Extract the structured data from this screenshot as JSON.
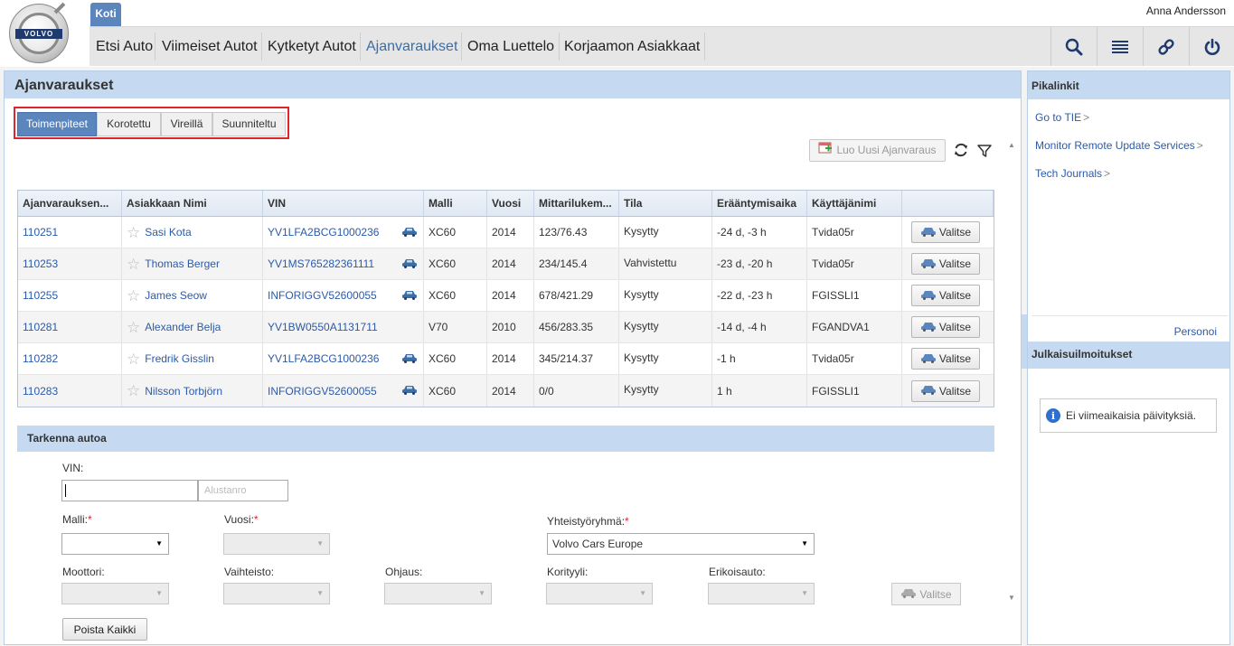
{
  "header": {
    "logo_text": "VOLVO",
    "home_tab": "Koti",
    "user": "Anna Andersson",
    "nav": [
      {
        "label": "Etsi Auto"
      },
      {
        "label": "Viimeiset Autot"
      },
      {
        "label": "Kytketyt Autot"
      },
      {
        "label": "Ajanvaraukset"
      },
      {
        "label": "Oma Luettelo"
      },
      {
        "label": "Korjaamon Asiakkaat"
      }
    ],
    "icons": [
      "search-icon",
      "list-icon",
      "link-icon",
      "power-icon"
    ]
  },
  "main": {
    "title": "Ajanvaraukset",
    "tabs": [
      {
        "label": "Toimenpiteet",
        "active": true
      },
      {
        "label": "Korotettu"
      },
      {
        "label": "Vireillä"
      },
      {
        "label": "Suunniteltu"
      }
    ],
    "new_button": "Luo Uusi Ajanvaraus",
    "columns": [
      "Ajanvarauksen...",
      "Asiakkaan Nimi",
      "VIN",
      "Malli",
      "Vuosi",
      "Mittarilukem...",
      "Tila",
      "Erääntymisaika",
      "Käyttäjänimi",
      ""
    ],
    "rows": [
      {
        "id": "110251",
        "name": "Sasi Kota",
        "vin": "YV1LFA2BCG1000236",
        "connected": true,
        "model": "XC60",
        "year": "2014",
        "mileage": "123/76.43",
        "status": "Kysytty",
        "due": "-24 d, -3 h",
        "user": "Tvida05r",
        "action": "Valitse"
      },
      {
        "id": "110253",
        "name": "Thomas Berger",
        "vin": "YV1MS765282361111",
        "connected": true,
        "model": "XC60",
        "year": "2014",
        "mileage": "234/145.4",
        "status": "Vahvistettu",
        "due": "-23 d, -20 h",
        "user": "Tvida05r",
        "action": "Valitse"
      },
      {
        "id": "110255",
        "name": "James Seow",
        "vin": "INFORIGGV52600055",
        "connected": true,
        "model": "XC60",
        "year": "2014",
        "mileage": "678/421.29",
        "status": "Kysytty",
        "due": "-22 d, -23 h",
        "user": "FGISSLI1",
        "action": "Valitse"
      },
      {
        "id": "110281",
        "name": "Alexander Belja",
        "vin": "YV1BW0550A1131711",
        "connected": false,
        "model": "V70",
        "year": "2010",
        "mileage": "456/283.35",
        "status": "Kysytty",
        "due": "-14 d, -4 h",
        "user": "FGANDVA1",
        "action": "Valitse"
      },
      {
        "id": "110282",
        "name": "Fredrik Gisslin",
        "vin": "YV1LFA2BCG1000236",
        "connected": true,
        "model": "XC60",
        "year": "2014",
        "mileage": "345/214.37",
        "status": "Kysytty",
        "due": "-1 h",
        "user": "Tvida05r",
        "action": "Valitse"
      },
      {
        "id": "110283",
        "name": "Nilsson Torbjörn",
        "vin": "INFORIGGV52600055",
        "connected": true,
        "model": "XC60",
        "year": "2014",
        "mileage": "0/0",
        "status": "Kysytty",
        "due": "1 h",
        "user": "FGISSLI1",
        "action": "Valitse"
      }
    ]
  },
  "refine": {
    "title": "Tarkenna autoa",
    "vin_label": "VIN:",
    "vin_value": "",
    "chassis_placeholder": "Alustanro",
    "malli_label": "Malli:",
    "malli_value": "",
    "vuosi_label": "Vuosi:",
    "vuosi_value": "",
    "group_label": "Yhteistyöryhmä:",
    "group_value": "Volvo Cars Europe",
    "moottori_label": "Moottori:",
    "vaihteisto_label": "Vaihteisto:",
    "ohjaus_label": "Ohjaus:",
    "korityyli_label": "Korityyli:",
    "erikoisauto_label": "Erikoisauto:",
    "select_button": "Valitse",
    "clear_button": "Poista Kaikki"
  },
  "sidebar": {
    "quick_title": "Pikalinkit",
    "links": [
      {
        "label": "Go to TIE"
      },
      {
        "label": "Monitor Remote Update Services"
      },
      {
        "label": "Tech Journals"
      }
    ],
    "personalize": "Personoi",
    "releases_title": "Julkaisuilmoitukset",
    "no_updates": "Ei viimeaikaisia päivityksiä."
  },
  "colors": {
    "accent": "#5b86bd",
    "panel_header": "#c5daf0",
    "link": "#2b5aa8",
    "highlight_border": "#e0232c",
    "brand_dark": "#1f3a6e"
  }
}
